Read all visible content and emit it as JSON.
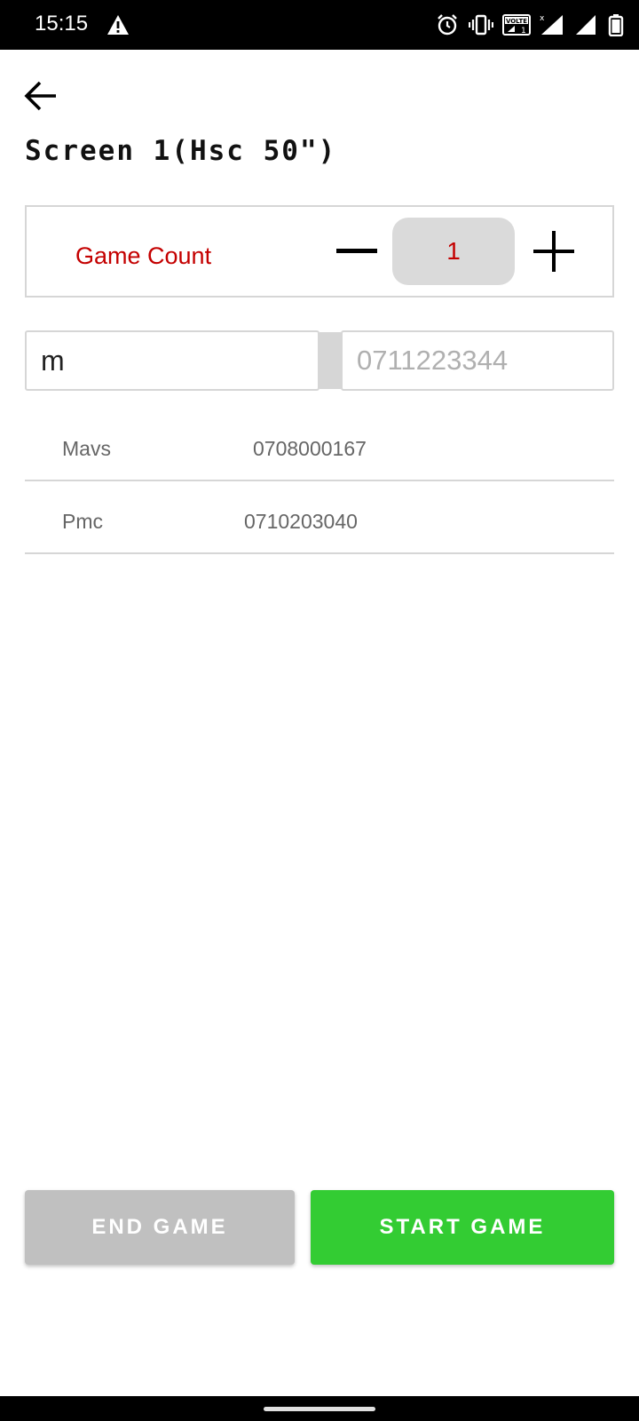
{
  "status_bar": {
    "time": "15:15",
    "icons": [
      "warning-icon",
      "alarm-icon",
      "vibrate-icon",
      "volte-icon",
      "signal-icon",
      "signal-icon",
      "battery-icon"
    ],
    "volte_label": "VOLTE"
  },
  "header": {
    "back_icon": "arrow-left-icon",
    "title": "Screen 1(Hsc 50\")"
  },
  "game_count": {
    "label": "Game Count",
    "value": "1",
    "minus_icon": "minus-icon",
    "plus_icon": "plus-icon"
  },
  "inputs": {
    "name_value": "m",
    "phone_placeholder": "0711223344",
    "phone_value": ""
  },
  "players": [
    {
      "name": "Mavs",
      "phone": "0708000167"
    },
    {
      "name": "Pmc",
      "phone": "0710203040"
    }
  ],
  "buttons": {
    "end_game": "END GAME",
    "start_game": "START GAME"
  },
  "colors": {
    "accent_red": "#c40000",
    "start_green": "#33cc33",
    "end_gray": "#c0c0c0"
  }
}
